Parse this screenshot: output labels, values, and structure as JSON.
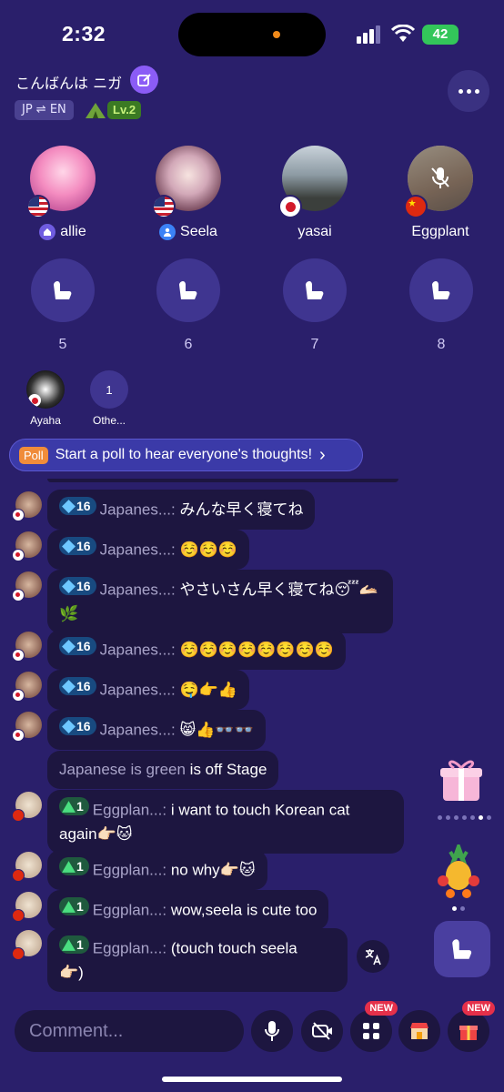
{
  "status": {
    "time": "2:32",
    "battery": "42"
  },
  "header": {
    "title": "こんばんは ニガ",
    "lang": "JP ⇌ EN",
    "level": "Lv.2"
  },
  "speakers": [
    {
      "name": "allie",
      "role": "host"
    },
    {
      "name": "Seela",
      "role": "member"
    },
    {
      "name": "yasai",
      "role": ""
    },
    {
      "name": "Eggplant",
      "role": ""
    }
  ],
  "seats": [
    "5",
    "6",
    "7",
    "8"
  ],
  "audience": [
    {
      "name": "Ayaha"
    },
    {
      "count": "1",
      "name": "Othe..."
    }
  ],
  "poll": {
    "tag": "Poll",
    "text": "Start a poll to hear everyone's thoughts!",
    "chevron": "›"
  },
  "chat": [
    {
      "level": "16",
      "user": "Japanes...:",
      "text": "みんな早く寝てね"
    },
    {
      "level": "16",
      "user": "Japanes...:",
      "text": "☺️☺️☺️"
    },
    {
      "level": "16",
      "user": "Japanes...:",
      "text": "やさいさん早く寝てね😴🫴🏻",
      "text2": "🌿"
    },
    {
      "level": "16",
      "user": "Japanes...:",
      "text": "☺️☺️☺️☺️☺️☺️☺️☺️"
    },
    {
      "level": "16",
      "user": "Japanes...:",
      "text": "🤤👉👍"
    },
    {
      "level": "16",
      "user": "Japanes...:",
      "text": "😸👍👓👓"
    },
    {
      "user": "Japanese is green",
      "text": " is off Stage"
    },
    {
      "level": "1",
      "user": "Eggplan...:",
      "text": "i want to touch Korean cat",
      "text2": "again👉🏻🐱"
    },
    {
      "level": "1",
      "user": "Eggplan...:",
      "text": "no why👉🏻🐱"
    },
    {
      "level": "1",
      "user": "Eggplan...:",
      "text": "wow,seela is cute too"
    },
    {
      "level": "1",
      "user": "Eggplan...:",
      "text": "(touch touch seela",
      "text2": "👉🏻)"
    }
  ],
  "bottom": {
    "placeholder": "Comment...",
    "new1": "NEW",
    "new2": "NEW"
  },
  "icons": [
    "pencil-icon",
    "more-icon",
    "seat-icon",
    "translate-icon",
    "mic-icon",
    "camera-off-icon",
    "apps-icon",
    "shop-icon",
    "gift-box-icon"
  ]
}
